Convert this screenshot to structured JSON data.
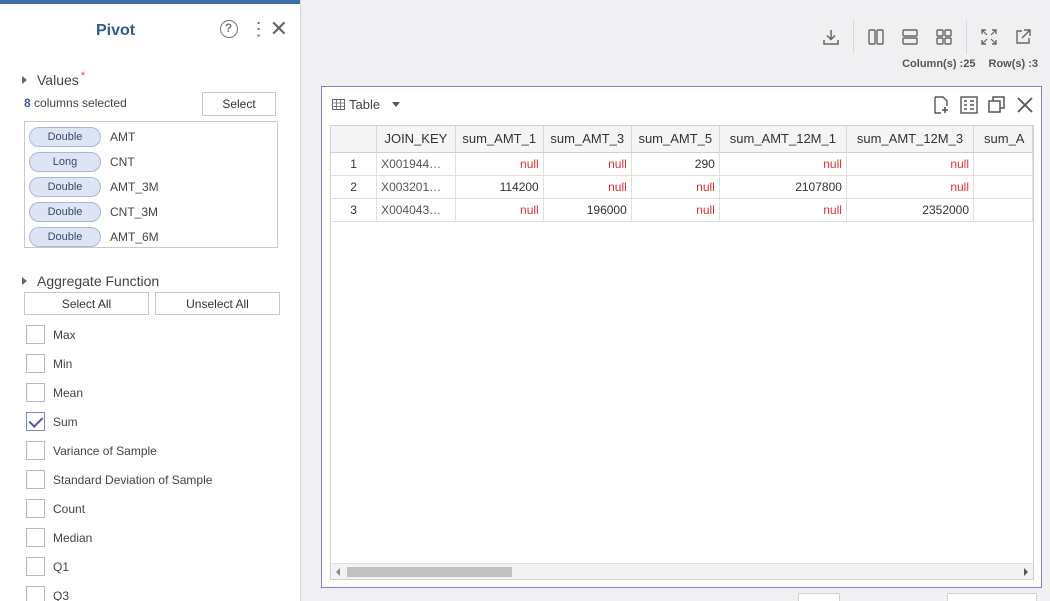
{
  "pivot": {
    "title": "Pivot",
    "help_icon": "?",
    "values_section": {
      "label": "Values",
      "required_mark": "*"
    },
    "columns_selected": {
      "count": "8",
      "text": "columns selected"
    },
    "select_button": "Select",
    "values": [
      {
        "type": "Double",
        "name": "AMT"
      },
      {
        "type": "Long",
        "name": "CNT"
      },
      {
        "type": "Double",
        "name": "AMT_3M"
      },
      {
        "type": "Double",
        "name": "CNT_3M"
      },
      {
        "type": "Double",
        "name": "AMT_6M"
      }
    ],
    "aggregate_section": {
      "label": "Aggregate Function"
    },
    "select_all": "Select All",
    "unselect_all": "Unselect All",
    "aggregates": [
      {
        "label": "Max",
        "checked": false
      },
      {
        "label": "Min",
        "checked": false
      },
      {
        "label": "Mean",
        "checked": false
      },
      {
        "label": "Sum",
        "checked": true
      },
      {
        "label": "Variance of Sample",
        "checked": false
      },
      {
        "label": "Standard Deviation of Sample",
        "checked": false
      },
      {
        "label": "Count",
        "checked": false
      },
      {
        "label": "Median",
        "checked": false
      },
      {
        "label": "Q1",
        "checked": false
      },
      {
        "label": "Q3",
        "checked": false
      }
    ]
  },
  "toolbar": {
    "icons": [
      "download-icon",
      "split-vertical-icon",
      "split-horizontal-icon",
      "grid-layout-icon",
      "expand-icon",
      "open-external-icon"
    ]
  },
  "counts": {
    "columns": "Column(s) :25",
    "rows": "Row(s) :3"
  },
  "table_card": {
    "title": "Table",
    "actions": [
      "add-document-icon",
      "table-settings-icon",
      "duplicate-icon",
      "close-icon"
    ]
  },
  "grid": {
    "headers": [
      "",
      "JOIN_KEY",
      "sum_AMT_1",
      "sum_AMT_3",
      "sum_AMT_5",
      "sum_AMT_12M_1",
      "sum_AMT_12M_3",
      "sum_A"
    ],
    "rows": [
      [
        "1",
        "X001944…",
        "null",
        "null",
        "290",
        "null",
        "null",
        ""
      ],
      [
        "2",
        "X003201…",
        "114200",
        "null",
        "null",
        "2107800",
        "null",
        ""
      ],
      [
        "3",
        "X004043…",
        "null",
        "196000",
        "null",
        "null",
        "2352000",
        ""
      ]
    ]
  },
  "colors": {
    "accent": "#4a55b8",
    "title": "#2f5d8a",
    "null_text": "#e03030",
    "card_border": "#7b84c4"
  }
}
